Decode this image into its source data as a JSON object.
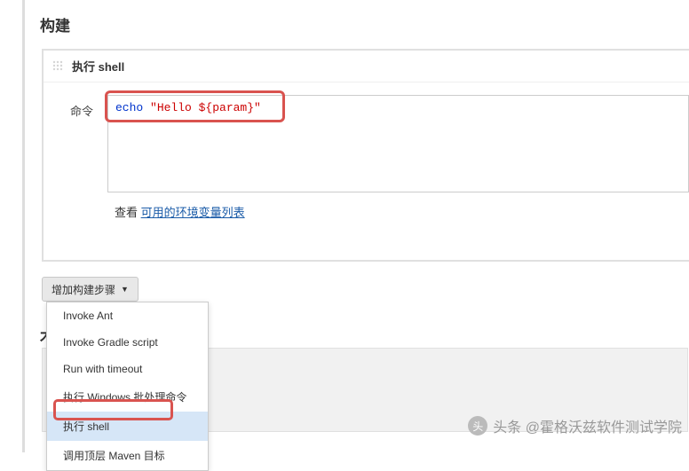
{
  "section": {
    "title": "构建"
  },
  "build_step": {
    "header": "执行 shell",
    "field_label": "命令",
    "code": {
      "cmd": "echo",
      "str": " \"Hello ${param}\""
    },
    "help_prefix": "查看 ",
    "help_link": "可用的环境变量列表"
  },
  "add_button": {
    "label": "增加构建步骤"
  },
  "dropdown_items": [
    "Invoke Ant",
    "Invoke Gradle script",
    "Run with timeout",
    "执行 Windows 批处理命令",
    "执行 shell",
    "调用顶层 Maven 目标"
  ],
  "selected_index": 4,
  "partial_heading": "木",
  "watermark": {
    "prefix": "头条 @",
    "text": "霍格沃兹软件测试学院"
  }
}
